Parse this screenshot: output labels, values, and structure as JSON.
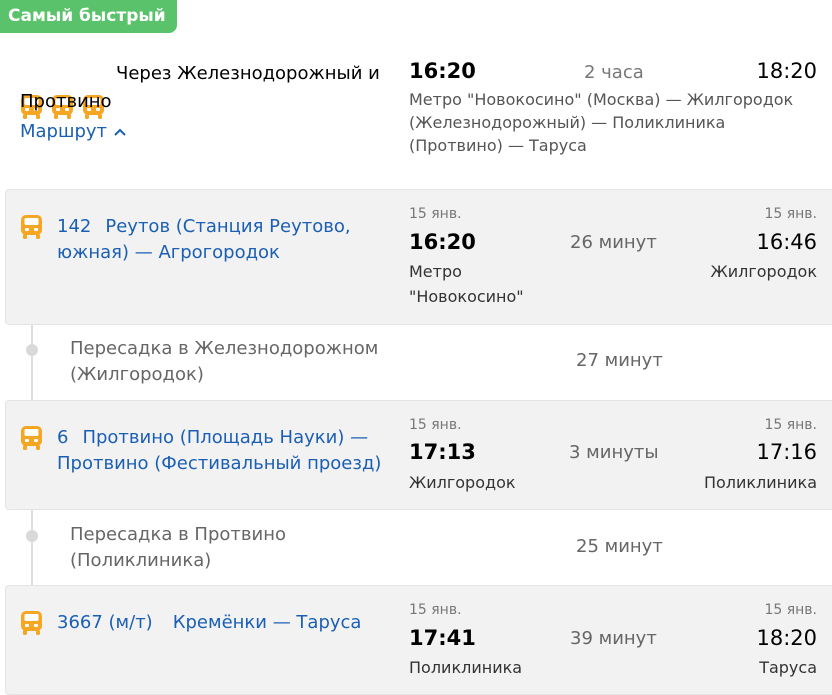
{
  "badge": "Самый быстрый",
  "summary": {
    "via": "Через Железнодорожный и Протвино",
    "route_link": "Маршрут",
    "depart": "16:20",
    "duration": "2 часа",
    "arrive": "18:20",
    "stops": "Метро \"Новокосино\" (Москва) — Жилгородок (Железнодорожный) — Поликлиника (Протвино) — Таруса"
  },
  "legs": [
    {
      "number": "142",
      "name": "Реутов (Станция Реутово, южная) — Агрогородок",
      "dep_date": "15 янв.",
      "dep_time": "16:20",
      "dep_place": "Метро \"Новокосино\"",
      "duration": "26 минут",
      "arr_date": "15 янв.",
      "arr_time": "16:46",
      "arr_place": "Жилгородок"
    },
    {
      "number": "6",
      "name": "Протвино (Площадь Науки) — Протвино (Фестивальный проезд)",
      "dep_date": "15 янв.",
      "dep_time": "17:13",
      "dep_place": "Жилгородок",
      "duration": "3 минуты",
      "arr_date": "15 янв.",
      "arr_time": "17:16",
      "arr_place": "Поликлиника"
    },
    {
      "number": "3667 (м/т)",
      "name": "Кремёнки — Таруса",
      "dep_date": "15 янв.",
      "dep_time": "17:41",
      "dep_place": "Поликлиника",
      "duration": "39 минут",
      "arr_date": "15 янв.",
      "arr_time": "18:20",
      "arr_place": "Таруса"
    }
  ],
  "transfers": [
    {
      "text": "Пересадка в Железнодорожном (Жилгородок)",
      "duration": "27 минут"
    },
    {
      "text": "Пересадка в Протвино (Поликлиника)",
      "duration": "25 минут"
    }
  ],
  "icons": {
    "bus": "bus-icon",
    "chevron": "chevron-up-icon"
  },
  "colors": {
    "badge": "#5ac26a",
    "bus": "#f5a623",
    "link": "#1a5fb4"
  }
}
